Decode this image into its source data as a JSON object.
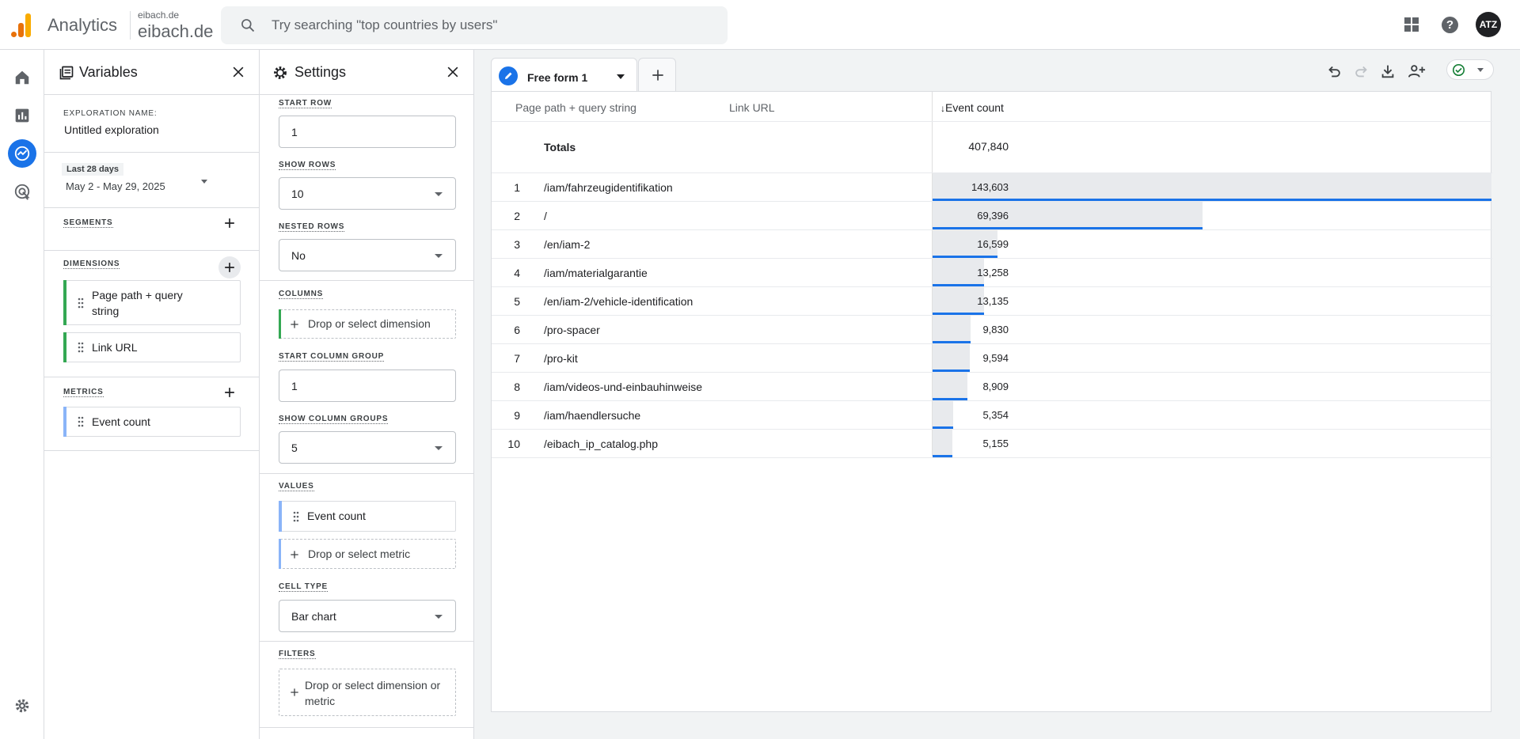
{
  "header": {
    "app_name": "Analytics",
    "account_small": "eibach.de",
    "account_big": "eibach.de",
    "search_placeholder": "Try searching \"top countries by users\"",
    "avatar_initials": "ATZ"
  },
  "variables": {
    "title": "Variables",
    "exploration_label": "EXPLORATION NAME:",
    "exploration_name": "Untitled exploration",
    "date_range_label": "Last 28 days",
    "date_range_value": "May 2 - May 29, 2025",
    "segments_label": "SEGMENTS",
    "dimensions_label": "DIMENSIONS",
    "dimensions": [
      "Page path + query string",
      "Link URL"
    ],
    "metrics_label": "METRICS",
    "metrics": [
      "Event count"
    ]
  },
  "settings": {
    "title": "Settings",
    "start_row_label": "START ROW",
    "start_row": "1",
    "show_rows_label": "SHOW ROWS",
    "show_rows": "10",
    "nested_rows_label": "NESTED ROWS",
    "nested_rows": "No",
    "columns_label": "COLUMNS",
    "columns_drop": "Drop or select dimension",
    "start_col_group_label": "START COLUMN GROUP",
    "start_col_group": "1",
    "show_col_groups_label": "SHOW COLUMN GROUPS",
    "show_col_groups": "5",
    "values_label": "VALUES",
    "values_item": "Event count",
    "values_drop": "Drop or select metric",
    "cell_type_label": "CELL TYPE",
    "cell_type": "Bar chart",
    "filters_label": "FILTERS",
    "filters_drop": "Drop or select dimension or metric"
  },
  "tab": {
    "label": "Free form 1"
  },
  "table": {
    "col_dim1": "Page path + query string",
    "col_dim2": "Link URL",
    "col_metric": "Event count",
    "sort_arrow": "↓",
    "totals_label": "Totals",
    "totals_value": "407,840",
    "rows": [
      {
        "idx": "1",
        "path": "/iam/fahrzeugidentifikation",
        "value": "143,603",
        "num": 143603
      },
      {
        "idx": "2",
        "path": "/",
        "value": "69,396",
        "num": 69396
      },
      {
        "idx": "3",
        "path": "/en/iam-2",
        "value": "16,599",
        "num": 16599
      },
      {
        "idx": "4",
        "path": "/iam/materialgarantie",
        "value": "13,258",
        "num": 13258
      },
      {
        "idx": "5",
        "path": "/en/iam-2/vehicle-identification",
        "value": "13,135",
        "num": 13135
      },
      {
        "idx": "6",
        "path": "/pro-spacer",
        "value": "9,830",
        "num": 9830
      },
      {
        "idx": "7",
        "path": "/pro-kit",
        "value": "9,594",
        "num": 9594
      },
      {
        "idx": "8",
        "path": "/iam/videos-und-einbauhinweise",
        "value": "8,909",
        "num": 8909
      },
      {
        "idx": "9",
        "path": "/iam/haendlersuche",
        "value": "5,354",
        "num": 5354
      },
      {
        "idx": "10",
        "path": "/eibach_ip_catalog.php",
        "value": "5,155",
        "num": 5155
      }
    ]
  },
  "colors": {
    "accent": "#1a73e8",
    "dimension_bar": "#34a853",
    "metric_bar": "#8ab4f8"
  }
}
